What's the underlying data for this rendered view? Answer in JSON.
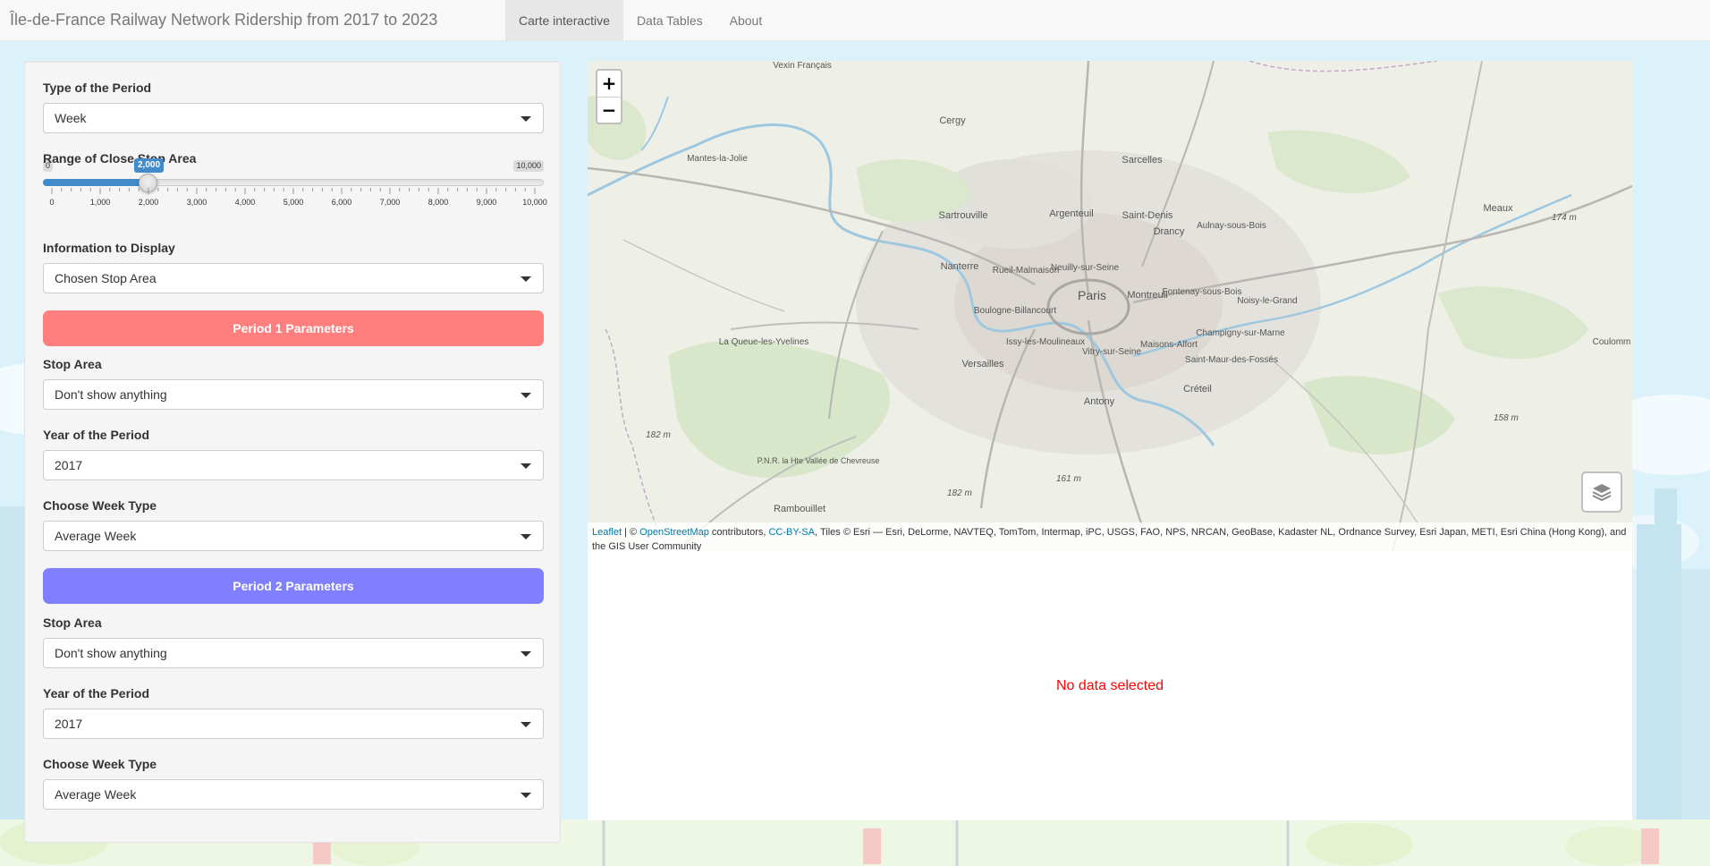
{
  "app": {
    "title": "Île-de-France Railway Network Ridership from 2017 to 2023",
    "tabs": [
      {
        "label": "Carte interactive",
        "active": true
      },
      {
        "label": "Data Tables",
        "active": false
      },
      {
        "label": "About",
        "active": false
      }
    ]
  },
  "sidebar": {
    "period_type": {
      "label": "Type of the Period",
      "value": "Week"
    },
    "range": {
      "label": "Range of Close Stop Area",
      "min_label": "0",
      "max_label": "10,000",
      "value_label": "2,000",
      "min": 0,
      "max": 10000,
      "value": 2000,
      "ticks": [
        "0",
        "1,000",
        "2,000",
        "3,000",
        "4,000",
        "5,000",
        "6,000",
        "7,000",
        "8,000",
        "9,000",
        "10,000"
      ]
    },
    "info_display": {
      "label": "Information to Display",
      "value": "Chosen Stop Area"
    },
    "period1": {
      "header": "Period 1 Parameters",
      "color": "#ff7f7f",
      "stop_area": {
        "label": "Stop Area",
        "value": "Don't show anything"
      },
      "year": {
        "label": "Year of the Period",
        "value": "2017"
      },
      "week_type": {
        "label": "Choose Week Type",
        "value": "Average Week"
      }
    },
    "period2": {
      "header": "Period 2 Parameters",
      "color": "#7f7fff",
      "stop_area": {
        "label": "Stop Area",
        "value": "Don't show anything"
      },
      "year": {
        "label": "Year of the Period",
        "value": "2017"
      },
      "week_type": {
        "label": "Choose Week Type",
        "value": "Average Week"
      }
    }
  },
  "map": {
    "zoom_in": "+",
    "zoom_out": "−",
    "attribution": {
      "leaflet": "Leaflet",
      "sep": " | © ",
      "osm": "OpenStreetMap",
      "contributors": " contributors, ",
      "license": "CC-BY-SA",
      "tiles": ", Tiles © Esri — Esri, DeLorme, NAVTEQ, TomTom, Intermap, iPC, USGS, FAO, NPS, NRCAN, GeoBase, Kadaster NL, Ordnance Survey, Esri Japan, METI, Esri China (Hong Kong), and the GIS User Community"
    },
    "places": {
      "vexin": "Vexin Français",
      "cergy": "Cergy",
      "mantes": "Mantes-la-Jolie",
      "sarcelles": "Sarcelles",
      "sartrouville": "Sartrouville",
      "argenteuil": "Argenteuil",
      "saint_denis": "Saint-Denis",
      "drancy": "Drancy",
      "aulnay": "Aulnay-sous-Bois",
      "meaux": "Meaux",
      "nanterre": "Nanterre",
      "rueil": "Rueil-Malmaison",
      "neuilly": "Neuilly-sur-Seine",
      "paris": "Paris",
      "montreuil": "Montreuil",
      "fontenay": "Fontenay-sous-Bois",
      "noisy": "Noisy-le-Grand",
      "boulogne": "Boulogne-Billancourt",
      "la_queue": "La Queue-les-Yvelines",
      "champigny": "Champigny-sur-Marne",
      "issy": "Issy-les-Moulineaux",
      "vitry": "Vitry-sur-Seine",
      "maisons": "Maisons-Alfort",
      "saint_maur": "Saint-Maur-des-Fossés",
      "versailles": "Versailles",
      "coulommiers": "Coulomm",
      "creteil": "Créteil",
      "antony": "Antony",
      "pnr": "P.N.R. la Hte Vallée de Chevreuse",
      "rambouillet": "Rambouillet"
    },
    "elevations": [
      "174 m",
      "182 m",
      "182 m",
      "161 m",
      "158 m"
    ]
  },
  "output": {
    "message": "No data selected"
  }
}
